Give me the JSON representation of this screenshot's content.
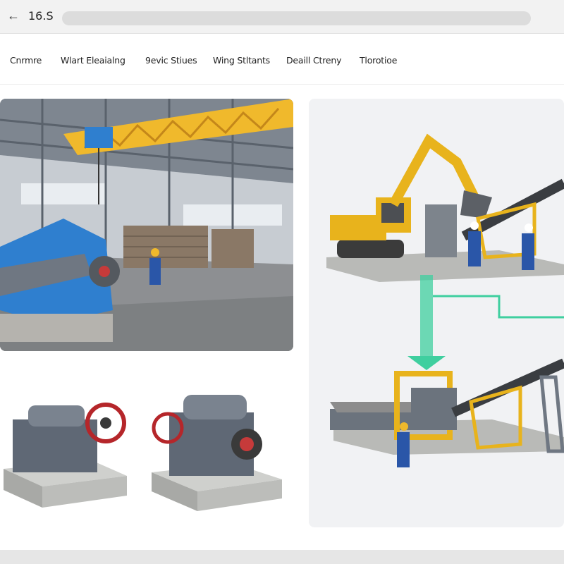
{
  "toolbar": {
    "back_icon": "arrow-left-icon",
    "back_glyph": "←",
    "version": "16.S"
  },
  "nav": {
    "items": [
      {
        "label": "Cnrmre"
      },
      {
        "label": "Wlart Eleaialng"
      },
      {
        "label": "9evic Stiues"
      },
      {
        "label": "Wing Stltants"
      },
      {
        "label": "Deaill Ctreny"
      },
      {
        "label": "Tlorotioe"
      }
    ]
  },
  "colors": {
    "accent_yellow": "#f0b92c",
    "crusher_blue": "#2f7fcf",
    "steel_gray": "#6f7782",
    "flow_green": "#3fcf9f",
    "worker_blue": "#2a56a8"
  }
}
